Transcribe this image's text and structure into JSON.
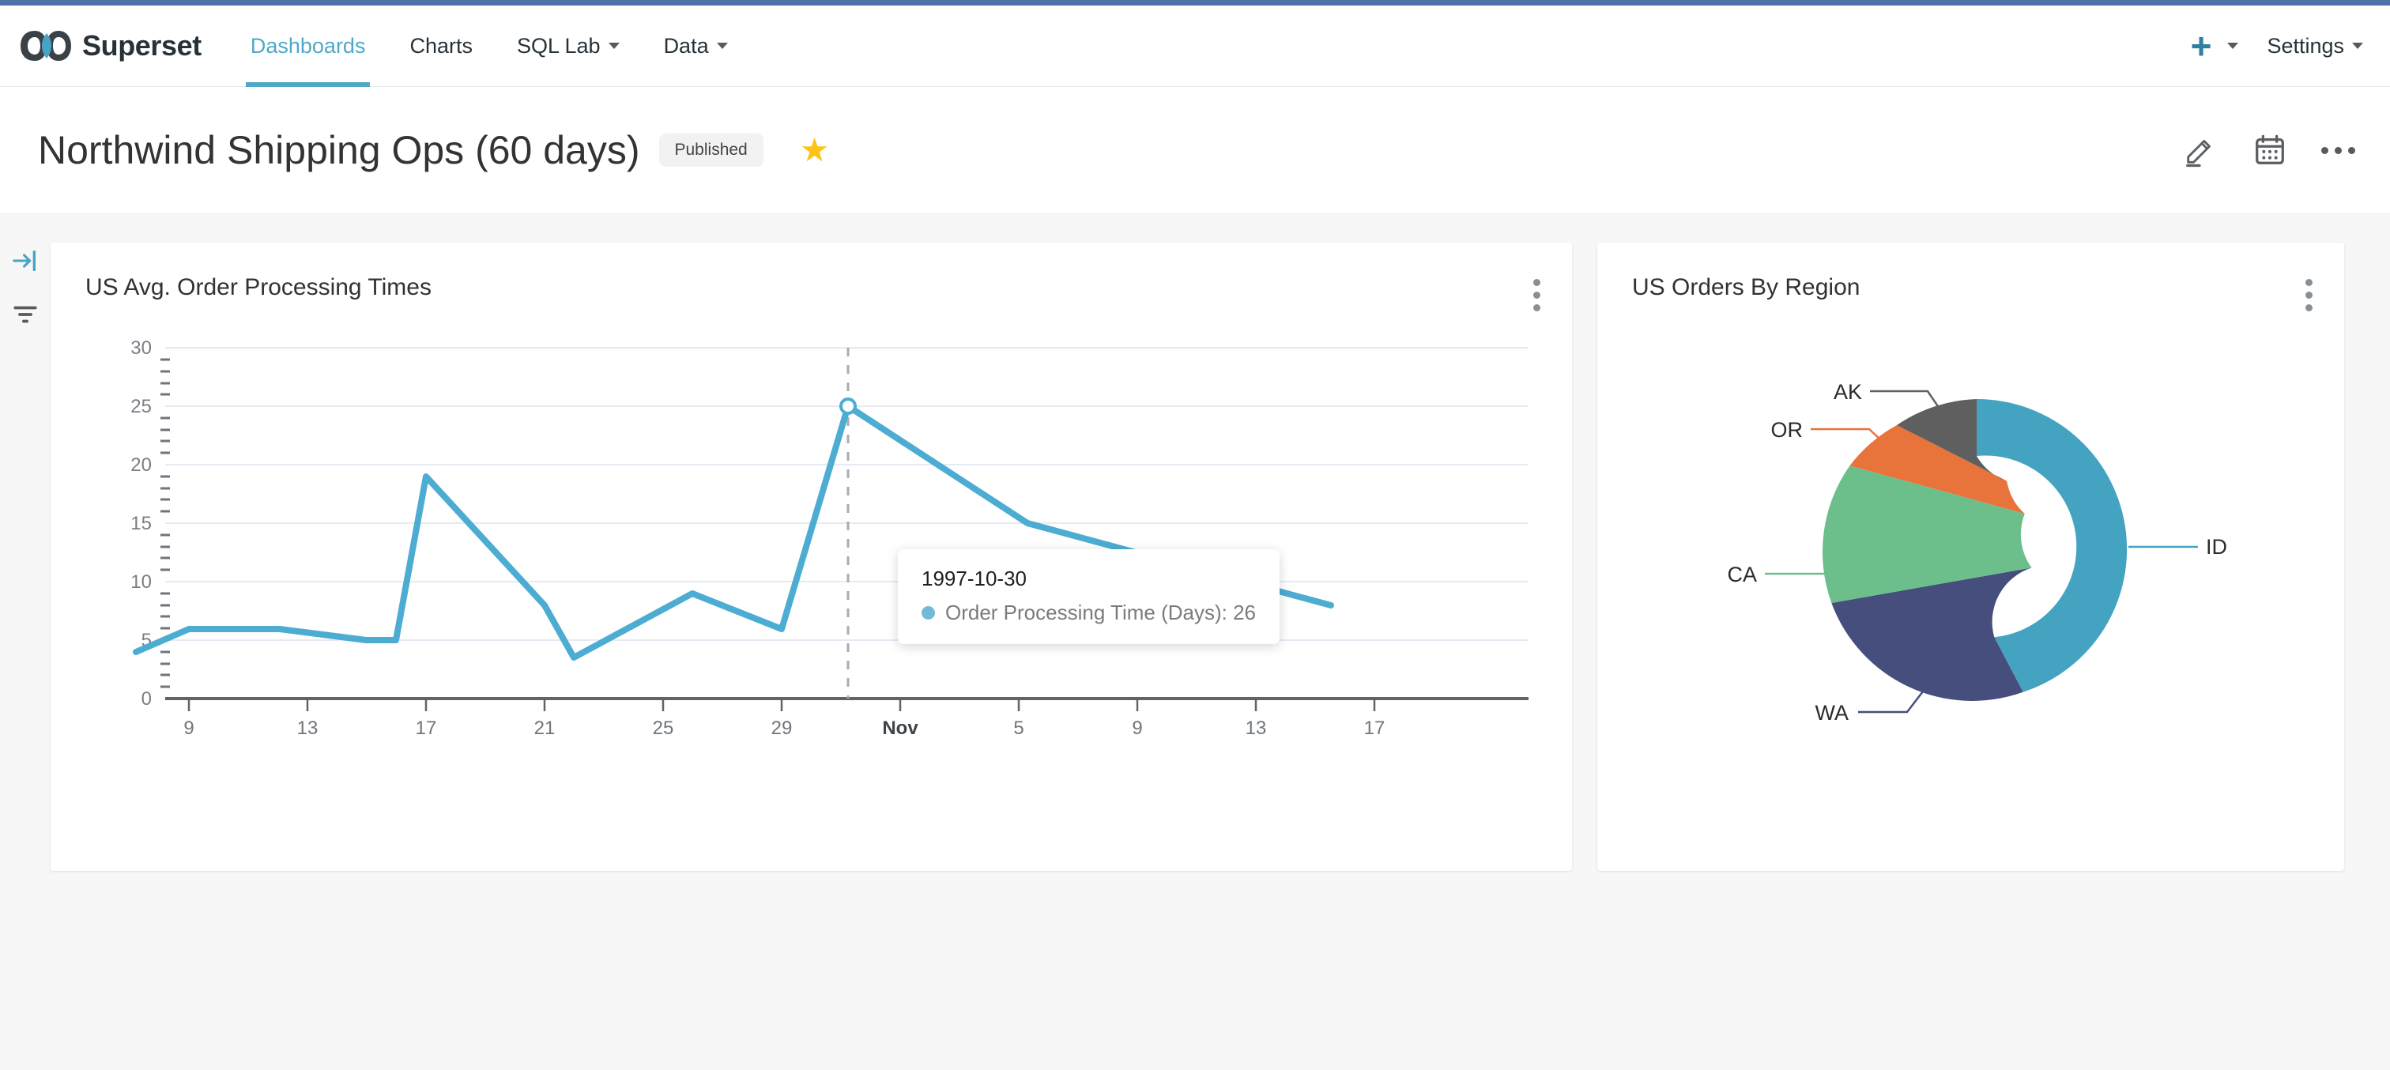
{
  "navbar": {
    "brand": "Superset",
    "brand_logo_icon": "infinity-logo-icon",
    "items": [
      {
        "label": "Dashboards",
        "active": true,
        "caret": false
      },
      {
        "label": "Charts",
        "active": false,
        "caret": false
      },
      {
        "label": "SQL Lab",
        "active": false,
        "caret": true
      },
      {
        "label": "Data",
        "active": false,
        "caret": true
      }
    ],
    "plus_label": "+",
    "plus_icon": "plus-icon",
    "settings_label": "Settings",
    "accent_color": "#4fa8c8",
    "topbar_color": "#4c72a8"
  },
  "dashboard": {
    "title": "Northwind Shipping Ops (60 days)",
    "status_badge": "Published",
    "favorite_icon": "star-icon",
    "favorite_star": "★",
    "favorite_color": "#fcc419",
    "actions": [
      {
        "name": "edit-dashboard",
        "icon": "pencil-icon"
      },
      {
        "name": "schedule",
        "icon": "calendar-icon"
      },
      {
        "name": "more-options",
        "icon": "ellipsis-horizontal-icon"
      }
    ]
  },
  "rail": [
    {
      "name": "expand-panel",
      "icon": "arrow-to-line-right-icon",
      "color": "#49a3c4"
    },
    {
      "name": "filters",
      "icon": "filter-icon",
      "color": "#5a5a5a"
    }
  ],
  "charts": [
    {
      "title": "US Avg. Order Processing Times",
      "menu_icon": "kebab-menu-icon"
    },
    {
      "title": "US Orders By Region",
      "menu_icon": "kebab-menu-icon"
    }
  ],
  "tooltip": {
    "date": "1997-10-30",
    "series_label": "Order Processing Time (Days)",
    "value": "26",
    "text": "Order Processing Time (Days): 26",
    "marker_color": "#73b9d8"
  },
  "chart_data": [
    {
      "type": "line",
      "title": "US Avg. Order Processing Times",
      "xlabel": "",
      "ylabel": "",
      "ylim": [
        0,
        30
      ],
      "yticks": [
        0,
        5,
        10,
        15,
        20,
        25,
        30
      ],
      "xticks": [
        "9",
        "13",
        "17",
        "21",
        "25",
        "29",
        "Nov",
        "5",
        "9",
        "13",
        "17"
      ],
      "x_bold_tick": "Nov",
      "grid": true,
      "legend": "none",
      "line_color": "#4cacd2",
      "highlight": {
        "x_label": "1997-10-30",
        "y": 26
      },
      "series": [
        {
          "name": "Order Processing Time (Days)",
          "x": [
            "1997-10-07",
            "1997-10-09",
            "1997-10-13",
            "1997-10-15",
            "1997-10-16",
            "1997-10-17",
            "1997-10-21",
            "1997-10-22",
            "1997-10-27",
            "1997-10-29",
            "1997-10-30",
            "1997-11-07",
            "1997-11-19"
          ],
          "values": [
            4,
            6,
            6,
            5,
            5,
            19,
            8,
            3.5,
            9,
            6,
            26,
            15,
            8
          ]
        }
      ]
    },
    {
      "type": "pie",
      "subtype": "donut",
      "title": "US Orders By Region",
      "labels": [
        "ID",
        "WA",
        "CA",
        "OR",
        "AK"
      ],
      "values": [
        45,
        26,
        13,
        7,
        9
      ],
      "colors": [
        "#45a3c2",
        "#454e7c",
        "#6cbf8b",
        "#e8743b",
        "#5f5f5f"
      ],
      "legend": "labels-with-leader-lines",
      "inner_radius_ratio": 0.38
    }
  ]
}
